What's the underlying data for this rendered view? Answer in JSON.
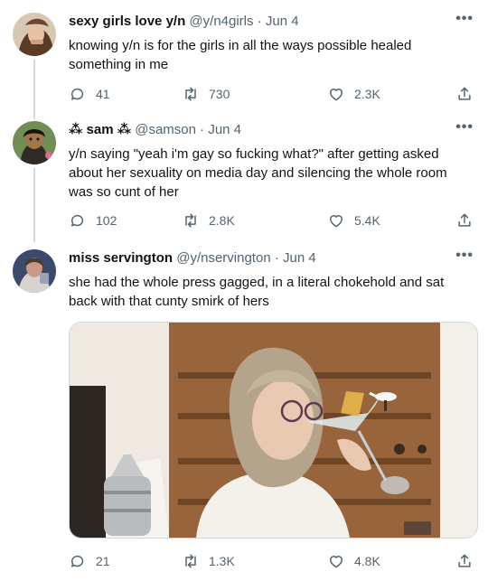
{
  "tweets": [
    {
      "name": "sexy girls love y/n",
      "handle": "@y/n4girls",
      "date": "Jun 4",
      "text": "knowing y/n is for the girls in all the ways possible healed something in me",
      "replies": "41",
      "retweets": "730",
      "likes": "2.3K"
    },
    {
      "name": "⁂ sam ⁂",
      "handle": "@samson",
      "date": "Jun 4",
      "text": "y/n saying \"yeah i'm gay so fucking what?\" after getting asked about her sexuality on media day and silencing the whole room was so cunt of her",
      "replies": "102",
      "retweets": "2.8K",
      "likes": "5.4K"
    },
    {
      "name": "miss servington",
      "handle": "@y/nservington",
      "date": "Jun 4",
      "text": "she had the whole press gagged, in a literal chokehold and sat back with that cunty smirk of hers",
      "replies": "21",
      "retweets": "1.3K",
      "likes": "4.8K"
    }
  ],
  "ui": {
    "dot": "·",
    "more": "•••"
  },
  "colors": {
    "secondary_text": "#536471",
    "thread_line": "#cfd9de",
    "text": "#0f1419"
  }
}
